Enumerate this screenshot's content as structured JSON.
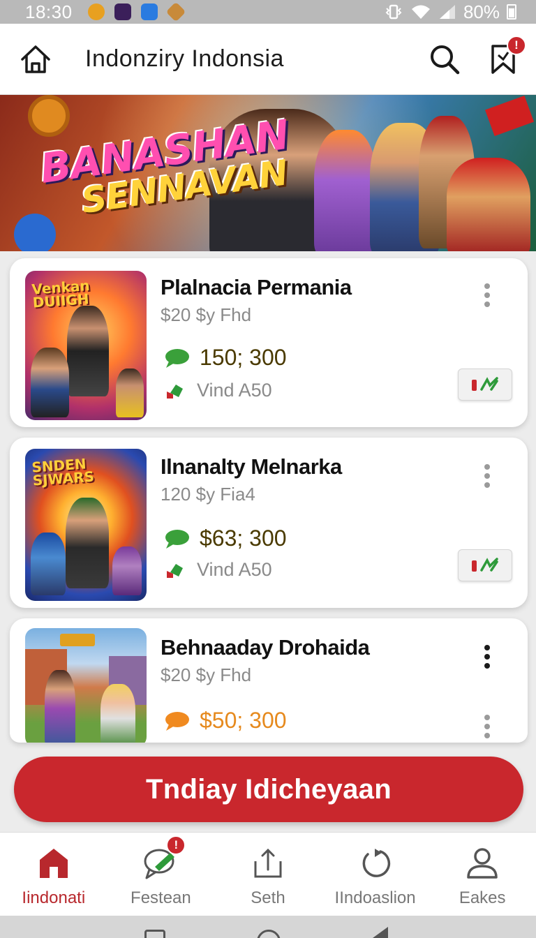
{
  "status_bar": {
    "time": "18:30",
    "battery": "80%"
  },
  "header": {
    "title": "Indonziry Indonsia",
    "bookmarks_badge": "!"
  },
  "banner": {
    "title_line1": "BANASHAN",
    "title_line2": "SENNAVAN"
  },
  "listings": [
    {
      "thumb_label": "Venkan DUIIGH",
      "name": "Plalnacia Permania",
      "subtitle": "$20 $y Fhd",
      "price": "150; 300",
      "price_color": "#4a3a00",
      "chat_color": "#3aa03a",
      "votes": "Vind A50"
    },
    {
      "thumb_label": "SNDEN SJWARS",
      "name": "Ilnanalty Melnarka",
      "subtitle": "120 $y Fiа4",
      "price": "$63; 300",
      "price_color": "#4a3a00",
      "chat_color": "#3aa03a",
      "votes": "Vind A50"
    },
    {
      "thumb_label": "",
      "name": "Behnaaday Drohaida",
      "subtitle": "$20 $y Fhd",
      "price": "$50; 300",
      "price_color": "#e68a1e",
      "chat_color": "#f08a20"
    }
  ],
  "cta": {
    "label": "Tndiay Idicheyaan"
  },
  "bottom_nav": [
    {
      "label": "Iindonati",
      "icon": "home-icon",
      "active": true
    },
    {
      "label": "Festean",
      "icon": "chat-edit-icon",
      "badge": "!"
    },
    {
      "label": "Seth",
      "icon": "upload-icon"
    },
    {
      "label": "IIndoaslion",
      "icon": "refresh-icon"
    },
    {
      "label": "Eakes",
      "icon": "profile-icon"
    }
  ],
  "colors": {
    "accent": "#c9272d",
    "positive": "#3aa03a"
  }
}
